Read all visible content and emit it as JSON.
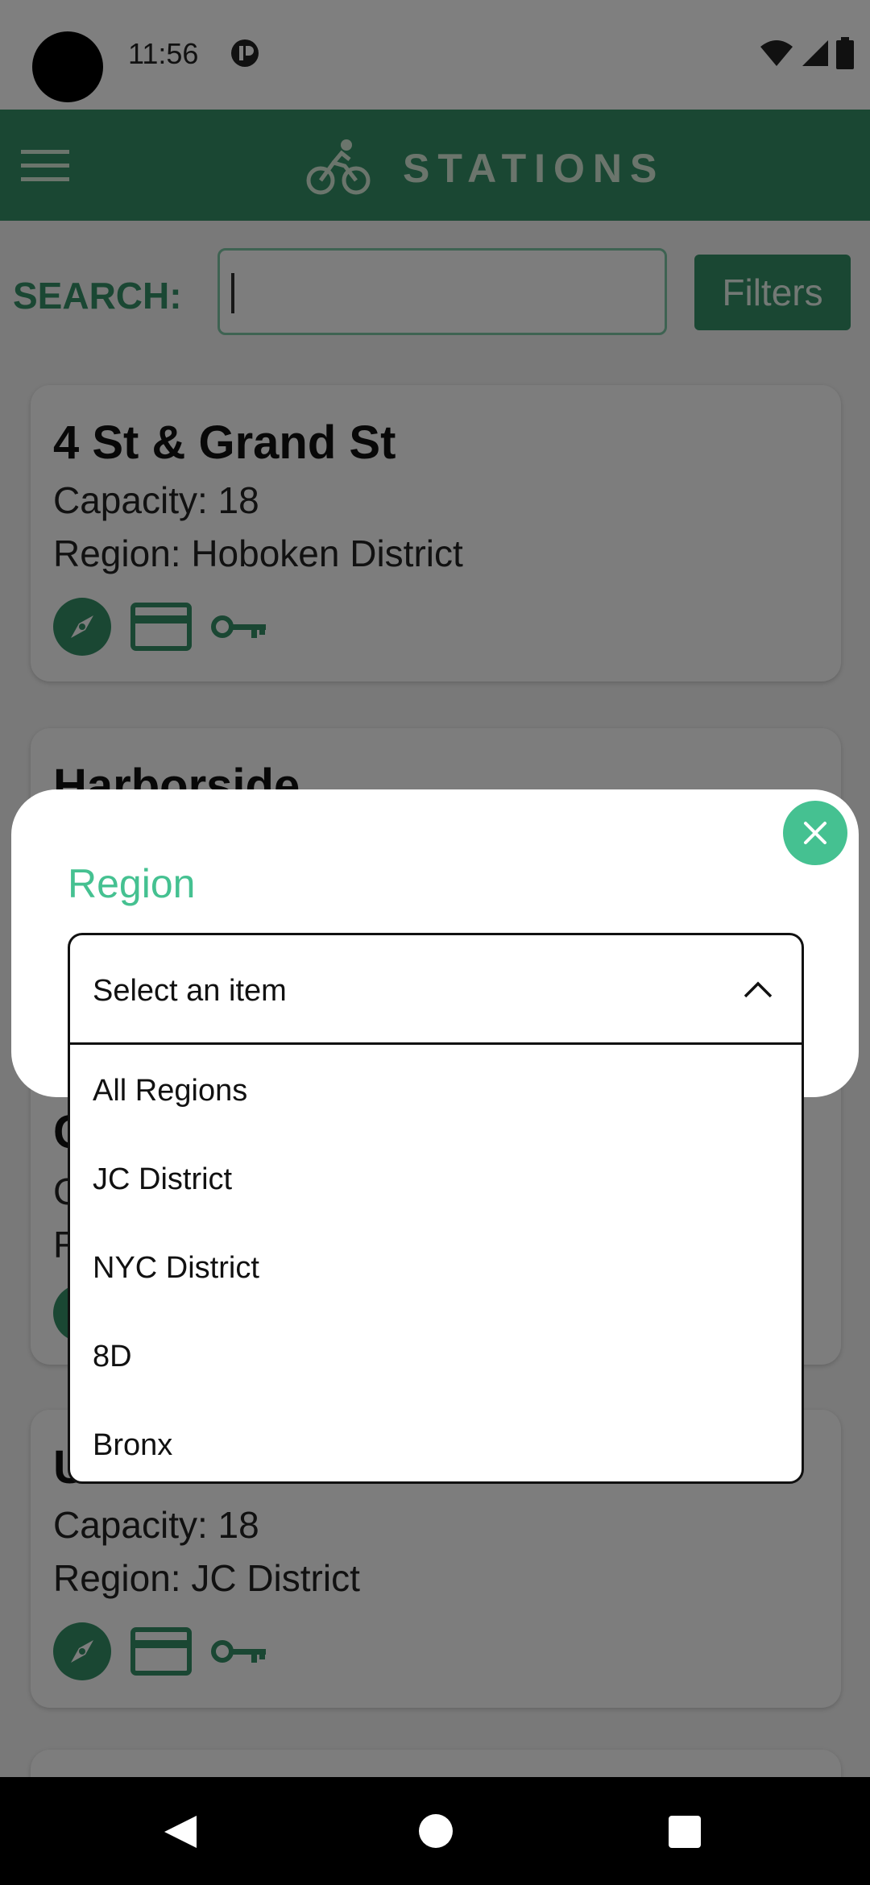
{
  "status_bar": {
    "time": "11:56"
  },
  "app_bar": {
    "title": "STATIONS"
  },
  "search": {
    "label": "SEARCH:",
    "value": "",
    "filters_label": "Filters"
  },
  "stations": [
    {
      "name": "4 St & Grand St",
      "capacity": "Capacity: 18",
      "region": "Region: Hoboken District"
    },
    {
      "name": "Harborside",
      "capacity": "",
      "region": ""
    },
    {
      "name": "C",
      "capacity": "C",
      "region": "R"
    },
    {
      "name": "U",
      "capacity": "Capacity: 18",
      "region": "Region: JC District"
    }
  ],
  "modal": {
    "label": "Region",
    "dropdown": {
      "placeholder": "Select an item",
      "options": [
        "All Regions",
        "JC District",
        "NYC District",
        "8D",
        "Bronx"
      ]
    }
  },
  "colors": {
    "primary": "#358f67",
    "accent": "#45c191"
  }
}
